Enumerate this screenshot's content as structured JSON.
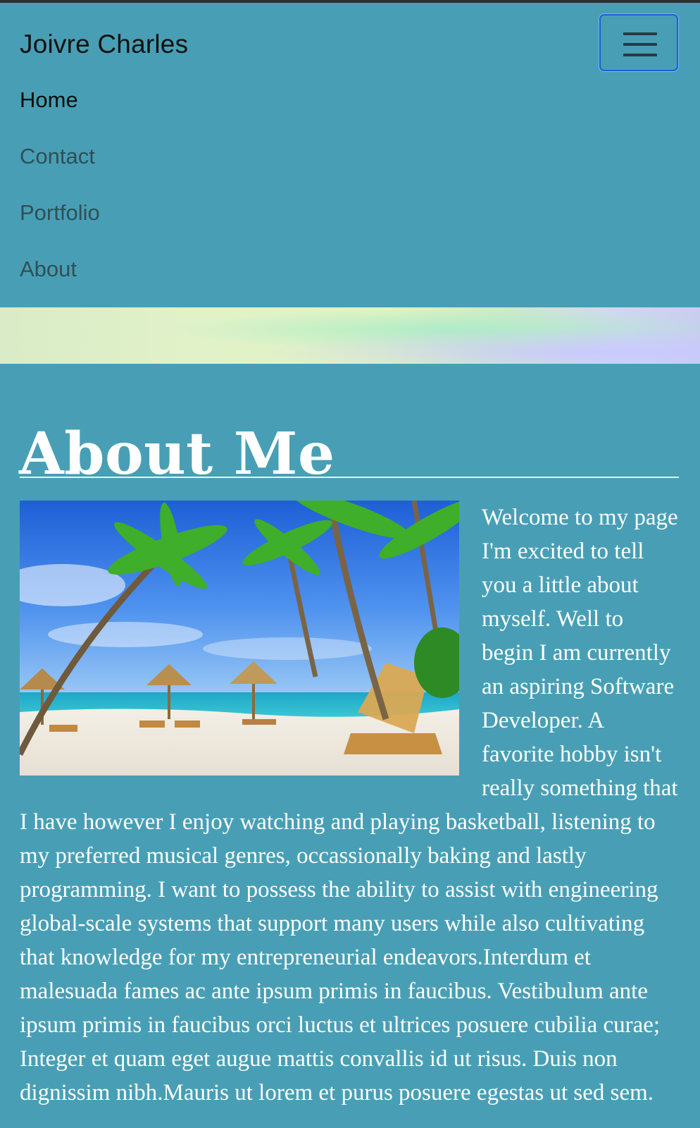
{
  "navbar": {
    "brand": "Joivre Charles",
    "toggler_icon": "hamburger-icon",
    "items": [
      {
        "label": "Home",
        "active": true
      },
      {
        "label": "Contact",
        "active": false
      },
      {
        "label": "Portfolio",
        "active": false
      },
      {
        "label": "About",
        "active": false
      }
    ]
  },
  "main": {
    "heading": "About Me",
    "image_subject": "beach with palm trees, thatched umbrellas and a wooden lounge chair",
    "bio": "Welcome to my page I'm excited to tell you a little about myself. Well to begin I am currently an aspiring Software Developer. A favorite hobby isn't really something that I have however I enjoy watching and playing basketball, listening to my preferred musical genres, occassionally baking and lastly programming. I want to possess the ability to assist with engineering global-scale systems that support many users while also cultivating that knowledge for my entrepreneurial endeavors.Interdum et malesuada fames ac ante ipsum primis in faucibus. Vestibulum ante ipsum primis in faucibus orci luctus et ultrices posuere cubilia curae; Integer et quam eget augue mattis convallis id ut risus. Duis non dignissim nibh.Mauris ut lorem et purus posuere egestas ut sed sem."
  },
  "colors": {
    "background": "#489fb5",
    "toggler_border": "#1f5fd1",
    "text": "#ffffff"
  }
}
